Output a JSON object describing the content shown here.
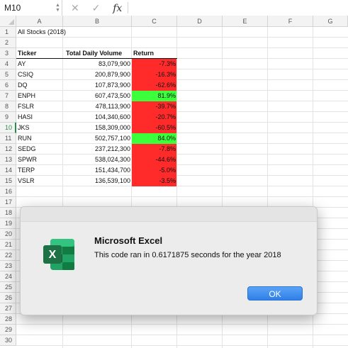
{
  "formula_bar": {
    "name_box": "M10",
    "cancel_glyph": "✕",
    "enter_glyph": "✓",
    "fx_label": "fx"
  },
  "columns": [
    "A",
    "B",
    "C",
    "D",
    "E",
    "F",
    "G"
  ],
  "rows": [
    "1",
    "2",
    "3",
    "4",
    "5",
    "6",
    "7",
    "8",
    "9",
    "10",
    "11",
    "12",
    "13",
    "14",
    "15",
    "16",
    "17",
    "18",
    "19",
    "20",
    "21",
    "22",
    "23",
    "24",
    "25",
    "26",
    "27",
    "28",
    "29",
    "30"
  ],
  "sheet": {
    "title": "All Stocks (2018)",
    "headers": [
      "Ticker",
      "Total Daily Volume",
      "Return"
    ],
    "data": [
      {
        "ticker": "AY",
        "volume": "83,079,900",
        "ret": "-7.3%",
        "status": "negative"
      },
      {
        "ticker": "CSIQ",
        "volume": "200,879,900",
        "ret": "-16.3%",
        "status": "negative"
      },
      {
        "ticker": "DQ",
        "volume": "107,873,900",
        "ret": "-62.6%",
        "status": "negative"
      },
      {
        "ticker": "ENPH",
        "volume": "607,473,500",
        "ret": "81.9%",
        "status": "positive"
      },
      {
        "ticker": "FSLR",
        "volume": "478,113,900",
        "ret": "-39.7%",
        "status": "negative"
      },
      {
        "ticker": "HASI",
        "volume": "104,340,600",
        "ret": "-20.7%",
        "status": "negative"
      },
      {
        "ticker": "JKS",
        "volume": "158,309,000",
        "ret": "-60.5%",
        "status": "negative"
      },
      {
        "ticker": "RUN",
        "volume": "502,757,100",
        "ret": "84.0%",
        "status": "positive"
      },
      {
        "ticker": "SEDG",
        "volume": "237,212,300",
        "ret": "-7.8%",
        "status": "negative"
      },
      {
        "ticker": "SPWR",
        "volume": "538,024,300",
        "ret": "-44.6%",
        "status": "negative"
      },
      {
        "ticker": "TERP",
        "volume": "151,434,700",
        "ret": "-5.0%",
        "status": "negative"
      },
      {
        "ticker": "VSLR",
        "volume": "136,539,100",
        "ret": "-3.5%",
        "status": "negative"
      }
    ]
  },
  "colors": {
    "negative": "#ff2a2a",
    "positive": "#3aff3a",
    "excel_green": "#1e7145",
    "ok_blue": "#2f7fe8"
  },
  "dialog": {
    "title": "Microsoft Excel",
    "message": "This code ran in 0.6171875 seconds for the year 2018",
    "ok_label": "OK",
    "icon_letter": "X"
  }
}
